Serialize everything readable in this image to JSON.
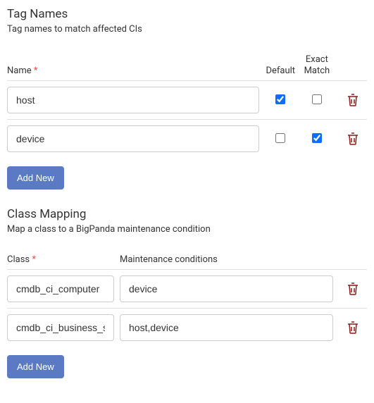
{
  "tagNames": {
    "title": "Tag Names",
    "desc": "Tag names to match affected CIs",
    "headers": {
      "name": "Name",
      "default": "Default",
      "exact1": "Exact",
      "exact2": "Match"
    },
    "rows": [
      {
        "name": "host",
        "default": true,
        "exact": false
      },
      {
        "name": "device",
        "default": false,
        "exact": true
      }
    ],
    "addButton": "Add New"
  },
  "classMapping": {
    "title": "Class Mapping",
    "desc": "Map a class to a BigPanda maintenance condition",
    "headers": {
      "class": "Class",
      "conditions": "Maintenance conditions"
    },
    "rows": [
      {
        "class": "cmdb_ci_computer",
        "conditions": "device"
      },
      {
        "class": "cmdb_ci_business_service",
        "conditions": "host,device"
      }
    ],
    "addButton": "Add New"
  },
  "requiredMark": "*"
}
